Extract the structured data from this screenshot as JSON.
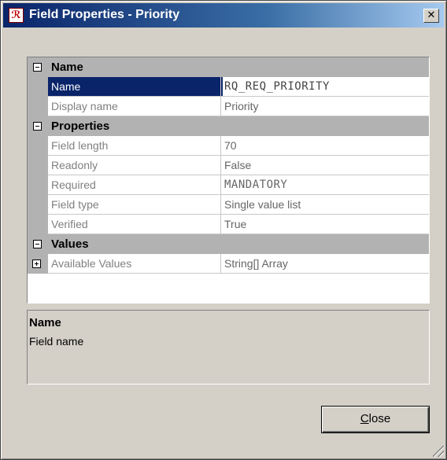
{
  "window": {
    "title": "Field Properties - Priority",
    "close_glyph": "✕"
  },
  "grid": {
    "categories": [
      {
        "label": "Name",
        "rows": [
          {
            "name": "Name",
            "value": "RQ_REQ_PRIORITY",
            "selected": true
          },
          {
            "name": "Display name",
            "value": "Priority"
          }
        ]
      },
      {
        "label": "Properties",
        "rows": [
          {
            "name": "Field length",
            "value": "70"
          },
          {
            "name": "Readonly",
            "value": "False"
          },
          {
            "name": "Required",
            "value": "MANDATORY"
          },
          {
            "name": "Field type",
            "value": "Single value list"
          },
          {
            "name": "Verified",
            "value": "True"
          }
        ]
      },
      {
        "label": "Values",
        "rows": [
          {
            "name": "Available Values",
            "value": "String[] Array",
            "expandable": true
          }
        ]
      }
    ]
  },
  "description": {
    "title": "Name",
    "text": "Field name"
  },
  "buttons": {
    "close_label": "Close"
  },
  "colors": {
    "titlebar_start": "#0a246a",
    "selection": "#0a246a",
    "category_band": "#b2b2b2",
    "face": "#d4d0c8"
  }
}
